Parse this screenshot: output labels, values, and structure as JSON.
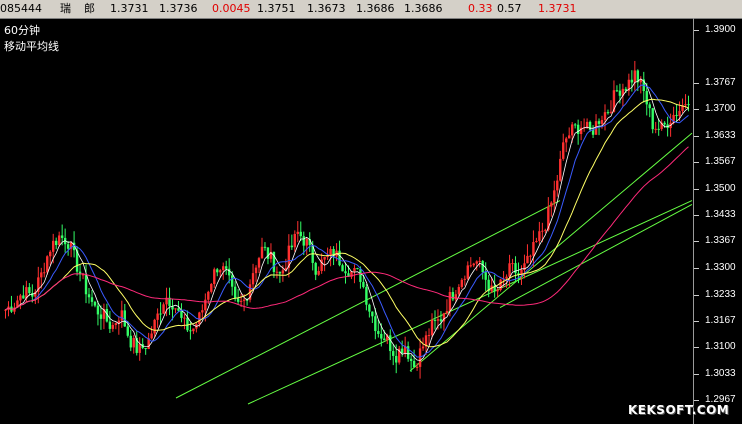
{
  "quote_bar": {
    "code": "085444",
    "name_1": "瑞",
    "name_2": "郎",
    "open": "1.3731",
    "prev": "1.3736",
    "change": "0.0045",
    "high": "1.3751",
    "low": "1.3673",
    "last": "1.3686",
    "bid": "1.3686",
    "change_pct": "0.33",
    "spread": "0.57",
    "latest": "1.3731"
  },
  "panel": {
    "title": "60分钟",
    "subtitle": "移动平均线"
  },
  "watermark": "KEKSOFT.COM",
  "colors": {
    "background": "#000000",
    "up_candle": "#ff3030",
    "down_candle": "#33ff66",
    "ma_short": "#ffffff",
    "ma_medium": "#ffff66",
    "ma_long_blue": "#3a5bff",
    "ma_longest": "#ff2a7a",
    "channel": "#66ff44"
  },
  "chart_data": {
    "type": "candlestick",
    "yticks": [
      "1.3900",
      "1.3767",
      "1.3700",
      "1.3633",
      "1.3567",
      "1.3500",
      "1.3433",
      "1.3367",
      "1.3300",
      "1.3233",
      "1.3167",
      "1.3100",
      "1.3033",
      "1.2967"
    ],
    "ylim": [
      1.2967,
      1.39
    ],
    "price_path": [
      1.3195,
      1.321,
      1.324,
      1.323,
      1.328,
      1.335,
      1.338,
      1.337,
      1.331,
      1.325,
      1.32,
      1.318,
      1.315,
      1.319,
      1.312,
      1.309,
      1.311,
      1.317,
      1.323,
      1.321,
      1.316,
      1.314,
      1.318,
      1.326,
      1.331,
      1.328,
      1.32,
      1.322,
      1.33,
      1.335,
      1.332,
      1.328,
      1.334,
      1.339,
      1.336,
      1.33,
      1.332,
      1.334,
      1.331,
      1.329,
      1.328,
      1.32,
      1.314,
      1.312,
      1.308,
      1.311,
      1.305,
      1.31,
      1.315,
      1.317,
      1.322,
      1.326,
      1.33,
      1.332,
      1.328,
      1.323,
      1.326,
      1.33,
      1.328,
      1.332,
      1.337,
      1.342,
      1.35,
      1.362,
      1.365,
      1.366,
      1.364,
      1.368,
      1.37,
      1.375,
      1.376,
      1.379,
      1.374,
      1.366,
      1.365,
      1.368,
      1.37,
      1.373
    ]
  }
}
